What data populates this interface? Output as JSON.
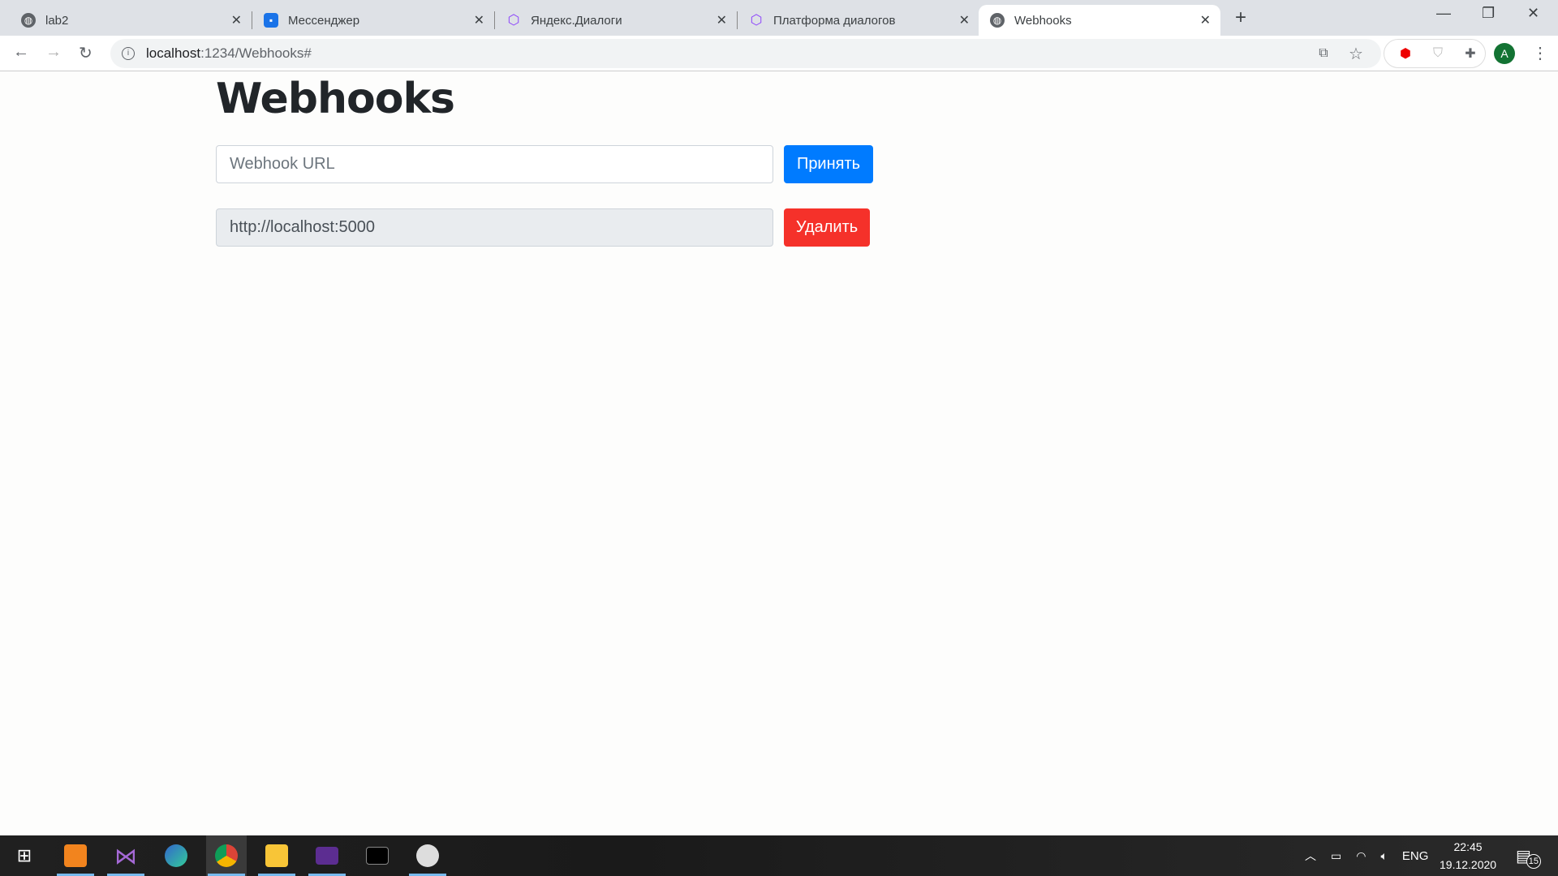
{
  "browser": {
    "tabs": [
      {
        "title": "lab2",
        "icon": "globe-icon"
      },
      {
        "title": "Мессенджер",
        "icon": "messenger-icon"
      },
      {
        "title": "Яндекс.Диалоги",
        "icon": "cube-icon"
      },
      {
        "title": "Платформа диалогов",
        "icon": "cube-icon"
      },
      {
        "title": "Webhooks",
        "icon": "globe-icon",
        "active": true
      }
    ],
    "url_host": "localhost",
    "url_path": ":1234/Webhooks#",
    "profile_initial": "A"
  },
  "page": {
    "title": "Webhooks",
    "url_input_placeholder": "Webhook URL",
    "accept_label": "Принять",
    "webhooks": [
      {
        "url": "http://localhost:5000",
        "delete_label": "Удалить"
      }
    ]
  },
  "colors": {
    "primary": "#007bff",
    "danger": "#f5312a"
  },
  "taskbar": {
    "lang": "ENG",
    "time": "22:45",
    "date": "19.12.2020",
    "notifications": "15"
  }
}
